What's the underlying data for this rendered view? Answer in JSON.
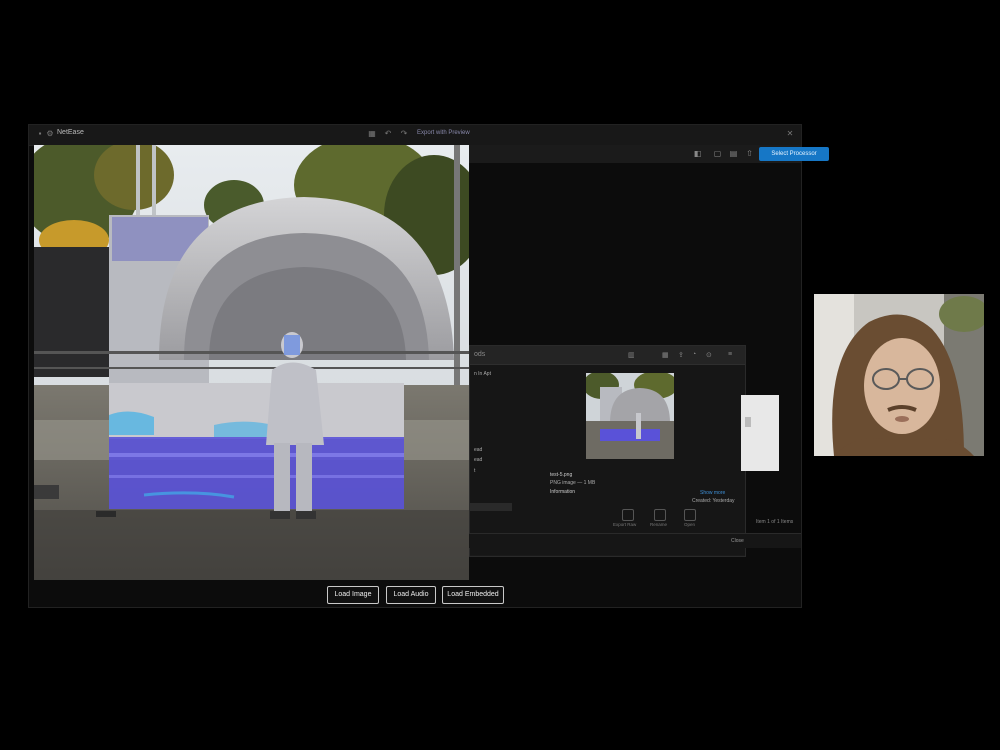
{
  "window": {
    "title": "NetEase",
    "link_text": "Export with Preview"
  },
  "toolbar": {
    "primary_button": "Select Processor"
  },
  "buttons": {
    "load_image": "Load Image",
    "load_audio": "Load Audio",
    "load_embedded": "Load Embedded"
  },
  "dialog": {
    "header_label": "ods",
    "filename": "test-5.png",
    "file_details": "PNG image — 1 MB",
    "info_label": "Information",
    "side_lines": [
      "n In Apt",
      "ead",
      "ead",
      "t"
    ],
    "action_link": "Show more",
    "action_sub": "Created: Yesterday",
    "dock": [
      "Export Raw",
      "Rename",
      "Open"
    ],
    "footer_status": "Item 1 of 1 Items",
    "close_label": "Close"
  },
  "colors": {
    "accent": "#1677c6",
    "overlay_purple": "#5a52d8"
  }
}
